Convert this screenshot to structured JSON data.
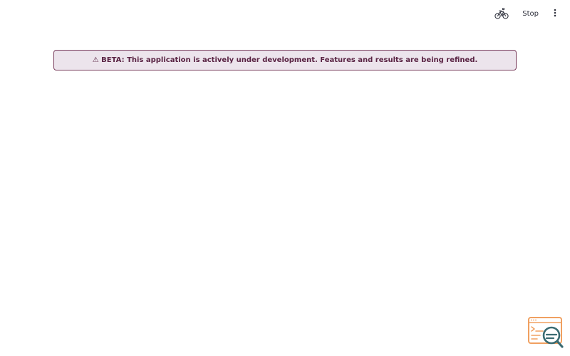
{
  "toolbar": {
    "running_icon": "bicycle-icon",
    "stop_label": "Stop",
    "menu_icon": "vertical-ellipsis-icon"
  },
  "banner": {
    "text": "⚠ BETA: This application is actively under development. Features and results are being refined.",
    "background": "#ece4ec",
    "border_color": "#7a3e5e",
    "text_color": "#5a2444"
  },
  "floating_badge": {
    "icon": "console-search-icon",
    "window_color": "#f0a060",
    "magnifier_color": "#3a6b72"
  }
}
